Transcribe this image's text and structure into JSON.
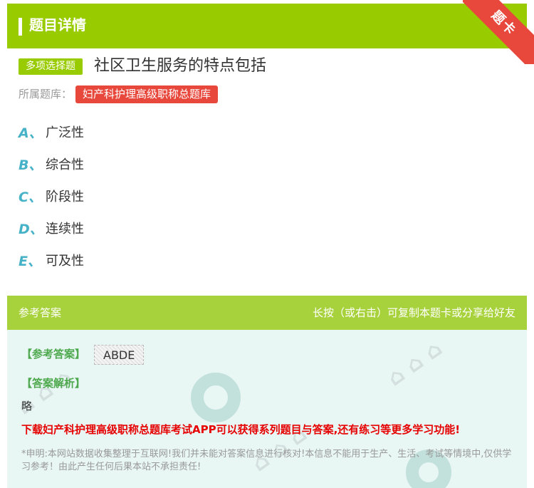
{
  "header": {
    "title": "题目详情",
    "ribbon": "题卡"
  },
  "question": {
    "type_label": "多项选择题",
    "text": "社区卫生服务的特点包括",
    "library_label": "所属题库：",
    "library_name": "妇产科护理高级职称总题库"
  },
  "options": [
    {
      "letter": "A、",
      "text": "广泛性"
    },
    {
      "letter": "B、",
      "text": "综合性"
    },
    {
      "letter": "C、",
      "text": "阶段性"
    },
    {
      "letter": "D、",
      "text": "连续性"
    },
    {
      "letter": "E、",
      "text": "可及性"
    }
  ],
  "answer": {
    "header_left": "参考答案",
    "header_right": "长按（或右击）可复制本题卡或分享给好友",
    "ref_label": "【参考答案】",
    "ref_value": "ABDE",
    "analysis_label": "【答案解析】",
    "analysis_text": "略",
    "promo": "下载妇产科护理高级职称总题库考试APP可以获得系列题目与答案,还有练习等更多学习功能!",
    "disclaimer": "*申明:本网站数据收集整理于互联网!我们并未能对答案信息进行核对!本信息不能用于生产、生活、考试等情境中,仅供学习参考！由此产生任何后果本站不承担责任!"
  },
  "colors": {
    "green": "#99cc00",
    "red": "#e8473c",
    "teal": "#46b2c8"
  }
}
